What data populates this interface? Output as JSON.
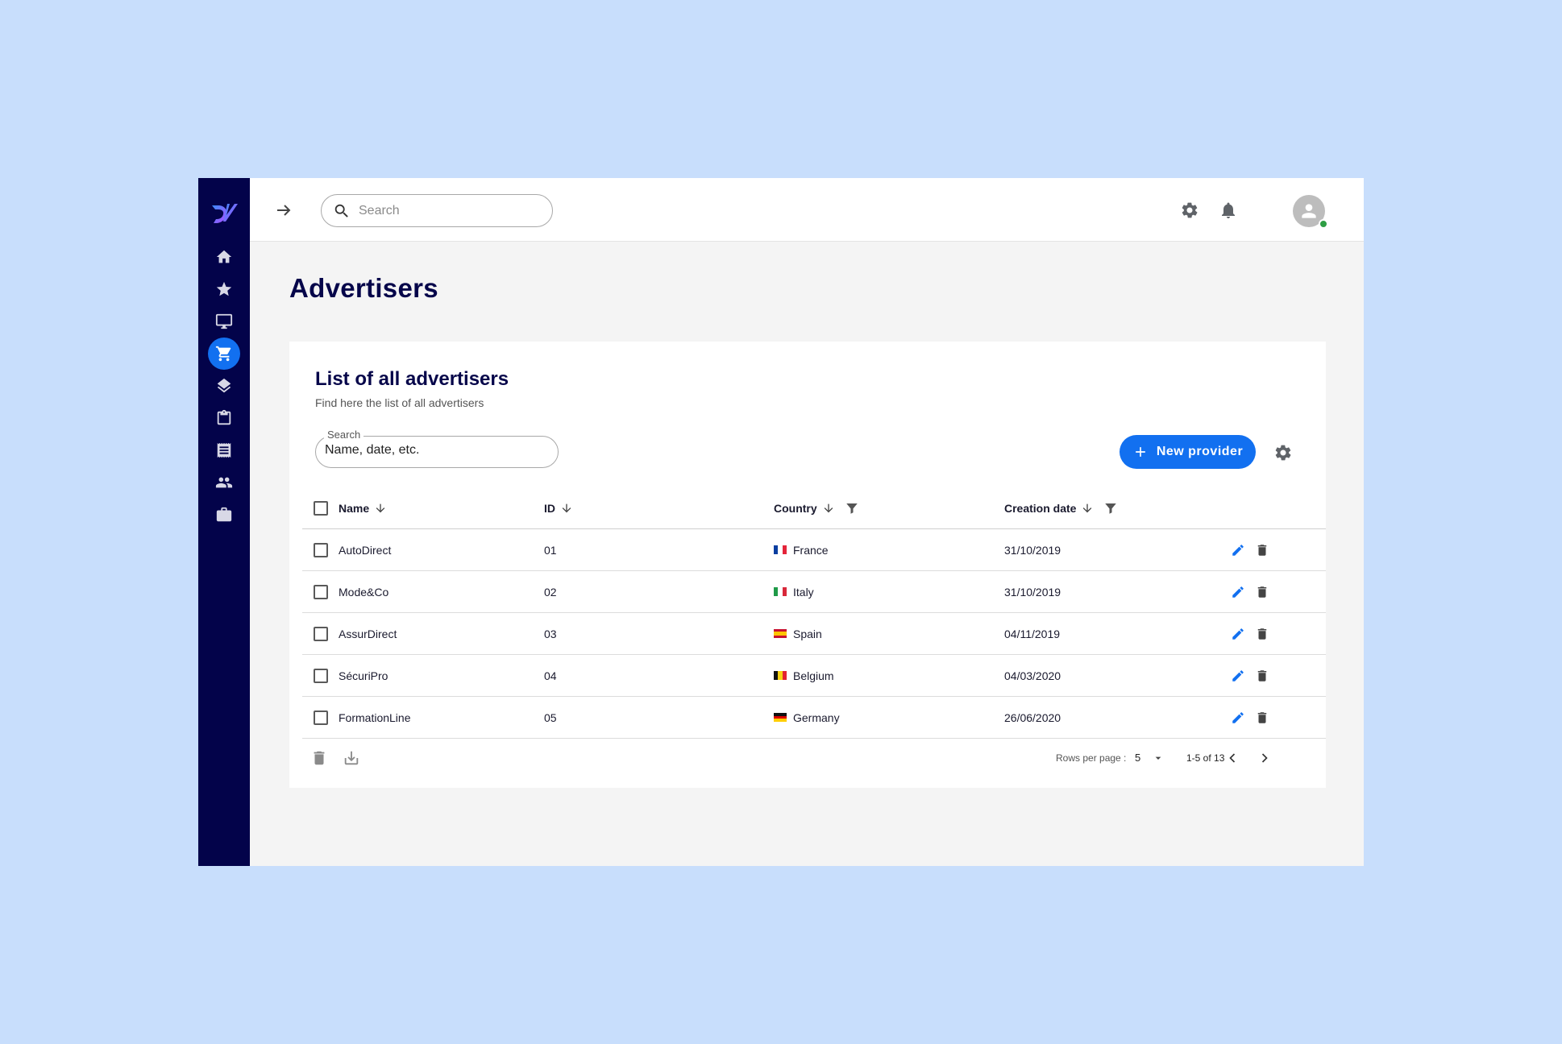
{
  "topbar": {
    "search_placeholder": "Search"
  },
  "page": {
    "title": "Advertisers"
  },
  "card": {
    "title": "List of all advertisers",
    "subtitle": "Find here the list of all advertisers",
    "search_label": "Search",
    "search_placeholder": "Name, date, etc.",
    "new_button_label": "New provider"
  },
  "table": {
    "headers": {
      "name": "Name",
      "id": "ID",
      "country": "Country",
      "date": "Creation date"
    },
    "rows": [
      {
        "name": "AutoDirect",
        "id": "01",
        "country": "France",
        "date": "31/10/2019"
      },
      {
        "name": "Mode&Co",
        "id": "02",
        "country": "Italy",
        "date": "31/10/2019"
      },
      {
        "name": "AssurDirect",
        "id": "03",
        "country": "Spain",
        "date": "04/11/2019"
      },
      {
        "name": "SécuriPro",
        "id": "04",
        "country": "Belgium",
        "date": "04/03/2020"
      },
      {
        "name": "FormationLine",
        "id": "05",
        "country": "Germany",
        "date": "26/06/2020"
      }
    ]
  },
  "pagination": {
    "rows_per_page_label": "Rows per page :",
    "rows_per_page_value": "5",
    "range": "1-5 of 13"
  },
  "sidebar": {
    "items": [
      "home-icon",
      "star-icon",
      "monitor-icon",
      "cart-icon",
      "layers-icon",
      "clipboard-icon",
      "receipt-icon",
      "people-icon",
      "briefcase-icon"
    ],
    "active": "cart-icon"
  },
  "colors": {
    "sidebar": "#03034a",
    "accent": "#1270f0",
    "background": "#c8defc",
    "status_online": "#2e9e44"
  }
}
